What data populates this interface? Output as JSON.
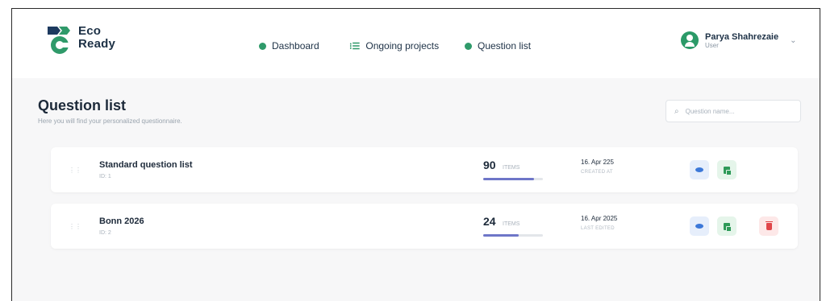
{
  "app": {
    "logo_line1": "Eco",
    "logo_line2": "Ready",
    "brand_color": "#2f9a6a"
  },
  "nav": [
    {
      "label": "Dashboard",
      "icon": "circle-dot-icon"
    },
    {
      "label": "Ongoing projects",
      "icon": "grid-icon"
    },
    {
      "label": "Question list",
      "icon": "circle-dot-icon"
    }
  ],
  "user": {
    "name": "Parya Shahrezaie",
    "role": "User"
  },
  "page": {
    "title": "Question list",
    "subtitle": "Here you will find your personalized questionnaire.",
    "search_placeholder": "Question name..."
  },
  "rows": [
    {
      "title": "Standard question list",
      "sub": "ID: 1",
      "count": "90",
      "count_unit": "ITEMS",
      "count_fraction": 0.85,
      "date": "16. Apr 225",
      "date_label": "CREATED AT",
      "actions": [
        "view",
        "export"
      ]
    },
    {
      "title": "Bonn 2026",
      "sub": "ID: 2",
      "count": "24",
      "count_unit": "ITEMS",
      "count_fraction": 0.6,
      "date": "16. Apr 2025",
      "date_label": "LAST EDITED",
      "actions": [
        "view",
        "export",
        "delete"
      ]
    }
  ],
  "colors": {
    "view": "#3c78d8",
    "export": "#2e9a58",
    "delete": "#e0464a",
    "progress": "#6e76c8"
  }
}
